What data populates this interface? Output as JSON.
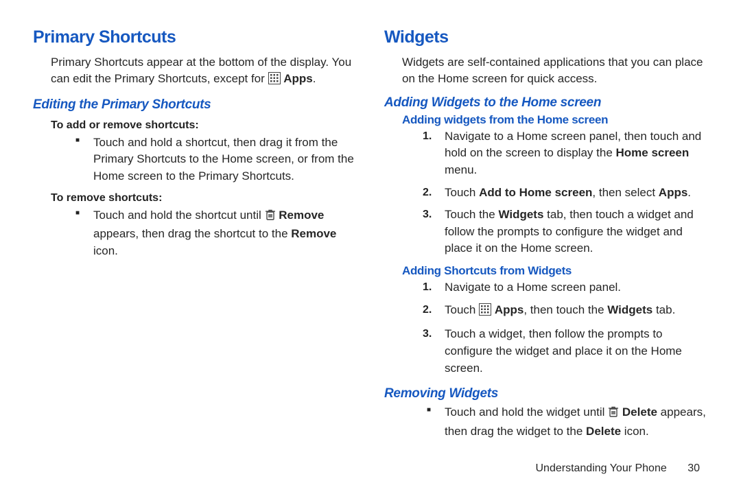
{
  "left": {
    "h1": "Primary Shortcuts",
    "intro_a": "Primary Shortcuts appear at the bottom of the display. You can edit the Primary Shortcuts, except for ",
    "intro_apps": "Apps",
    "intro_c": ".",
    "sub1": "Editing the Primary Shortcuts",
    "lead_add": "To add or remove shortcuts:",
    "bullet_add": "Touch and hold a shortcut, then drag it from the Primary Shortcuts to the Home screen, or from the Home screen to the Primary Shortcuts.",
    "lead_remove": "To remove shortcuts:",
    "bullet_remove_a": "Touch and hold the shortcut until ",
    "bullet_remove_remove": "Remove",
    "bullet_remove_b": " appears, then drag the shortcut to the ",
    "bullet_remove_remove2": "Remove",
    "bullet_remove_c": " icon."
  },
  "right": {
    "h1": "Widgets",
    "intro": "Widgets are self-contained applications that you can place on the Home screen for quick access.",
    "sub1": "Adding Widgets to the Home screen",
    "h3a": "Adding widgets from the Home screen",
    "a1_a": "Navigate to a Home screen panel, then touch and hold on the screen to display the ",
    "a1_hs": "Home screen",
    "a1_c": " menu.",
    "a2_a": "Touch ",
    "a2_add": "Add to Home screen",
    "a2_b": ", then select ",
    "a2_apps": "Apps",
    "a2_c": ".",
    "a3_a": "Touch the ",
    "a3_w": "Widgets",
    "a3_b": " tab, then touch a widget and follow the prompts to configure the widget and place it on the Home screen.",
    "h3b": "Adding Shortcuts from Widgets",
    "b1": "Navigate to a Home screen panel.",
    "b2_a": "Touch ",
    "b2_apps": "Apps",
    "b2_b": ", then touch the ",
    "b2_w": "Widgets",
    "b2_c": " tab.",
    "b3": "Touch a widget, then follow the prompts to configure the widget and place it on the Home screen.",
    "sub2": "Removing Widgets",
    "rm_a": "Touch and hold the widget until ",
    "rm_del": "Delete",
    "rm_b": " appears, then drag the widget to the ",
    "rm_del2": "Delete",
    "rm_c": " icon."
  },
  "footer": {
    "section": "Understanding Your Phone",
    "page": "30"
  }
}
